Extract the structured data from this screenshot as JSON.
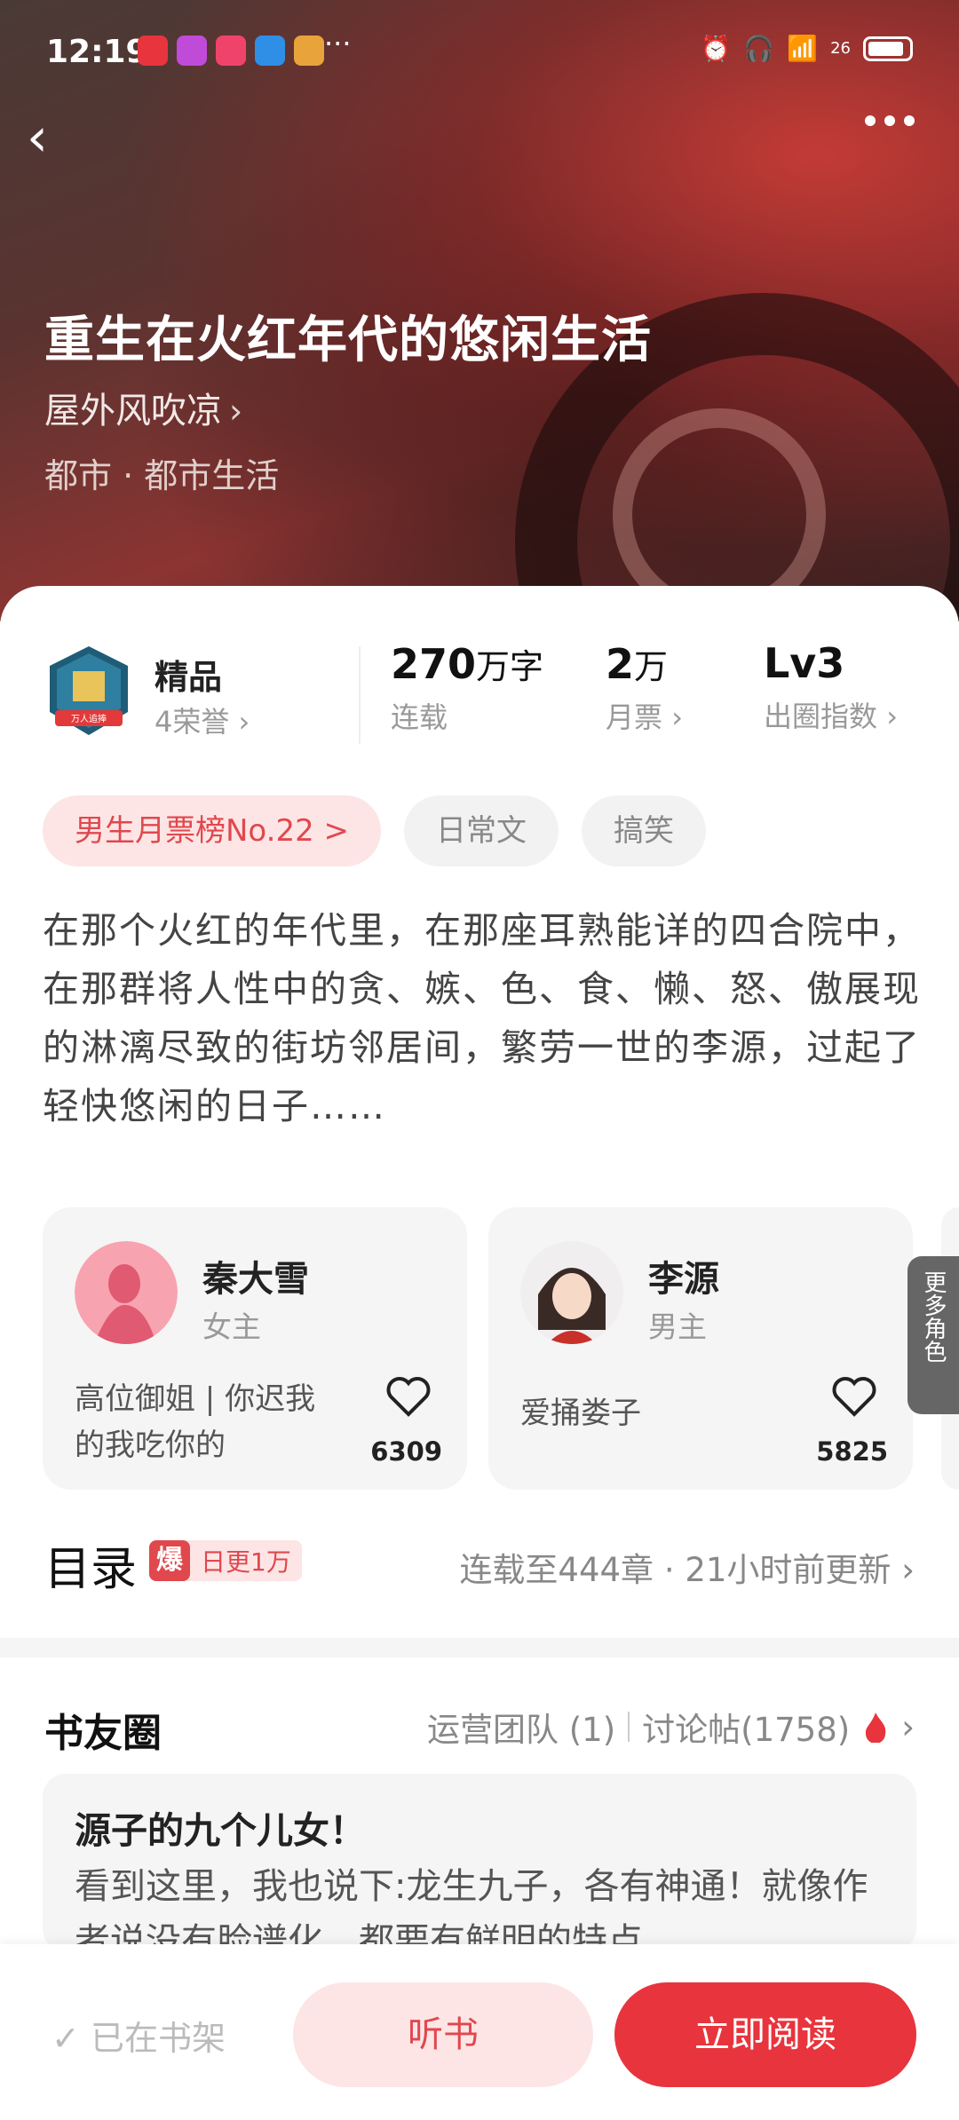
{
  "status": {
    "time": "12:19",
    "signal": "26"
  },
  "header": {
    "back_icon": "back-arrow-icon",
    "more_icon": "more-dots-icon"
  },
  "book": {
    "title": "重生在火红年代的悠闲生活",
    "author": "屋外风吹凉",
    "genre": "都市 · 都市生活"
  },
  "stats": {
    "quality": "精品",
    "honors": "4荣誉",
    "badge_text": "万人追捧",
    "words_num": "270",
    "words_unit": "万字",
    "words_label": "连载",
    "tickets_num": "2",
    "tickets_unit": "万",
    "tickets_label": "月票",
    "level": "Lv3",
    "level_label": "出圈指数"
  },
  "tags": [
    "男生月票榜No.22 >",
    "日常文",
    "搞笑"
  ],
  "description": "在那个火红的年代里，在那座耳熟能详的四合院中，在那群将人性中的贪、嫉、色、食、懒、怒、傲展现的淋漓尽致的街坊邻居间，繁劳一世的李源，过起了轻快悠闲的日子……",
  "roles": [
    {
      "name": "秦大雪",
      "role": "女主",
      "quote": "高位御姐 | 你迟我的我吃你的",
      "likes": "6309"
    },
    {
      "name": "李源",
      "role": "男主",
      "quote": "爱捅娄子",
      "likes": "5825"
    }
  ],
  "more_roles": "更多角色",
  "catalog": {
    "title": "目录",
    "fire_badge": "爆",
    "fire_text": "日更1万",
    "info": "连载至444章 · 21小时前更新"
  },
  "circle": {
    "title": "书友圈",
    "team": "运营团队 (1)",
    "posts": "讨论帖(1758)",
    "post_title": "源子的九个儿女！",
    "post_body": "看到这里，我也说下:龙生九子，各有神通！就像作者说没有脸谱化，都要有鲜明的特点，…"
  },
  "bottom": {
    "on_shelf": "已在书架",
    "listen": "听书",
    "read": "立即阅读"
  },
  "colors": {
    "accent": "#e8343d",
    "accent_light": "#fde5e5"
  }
}
